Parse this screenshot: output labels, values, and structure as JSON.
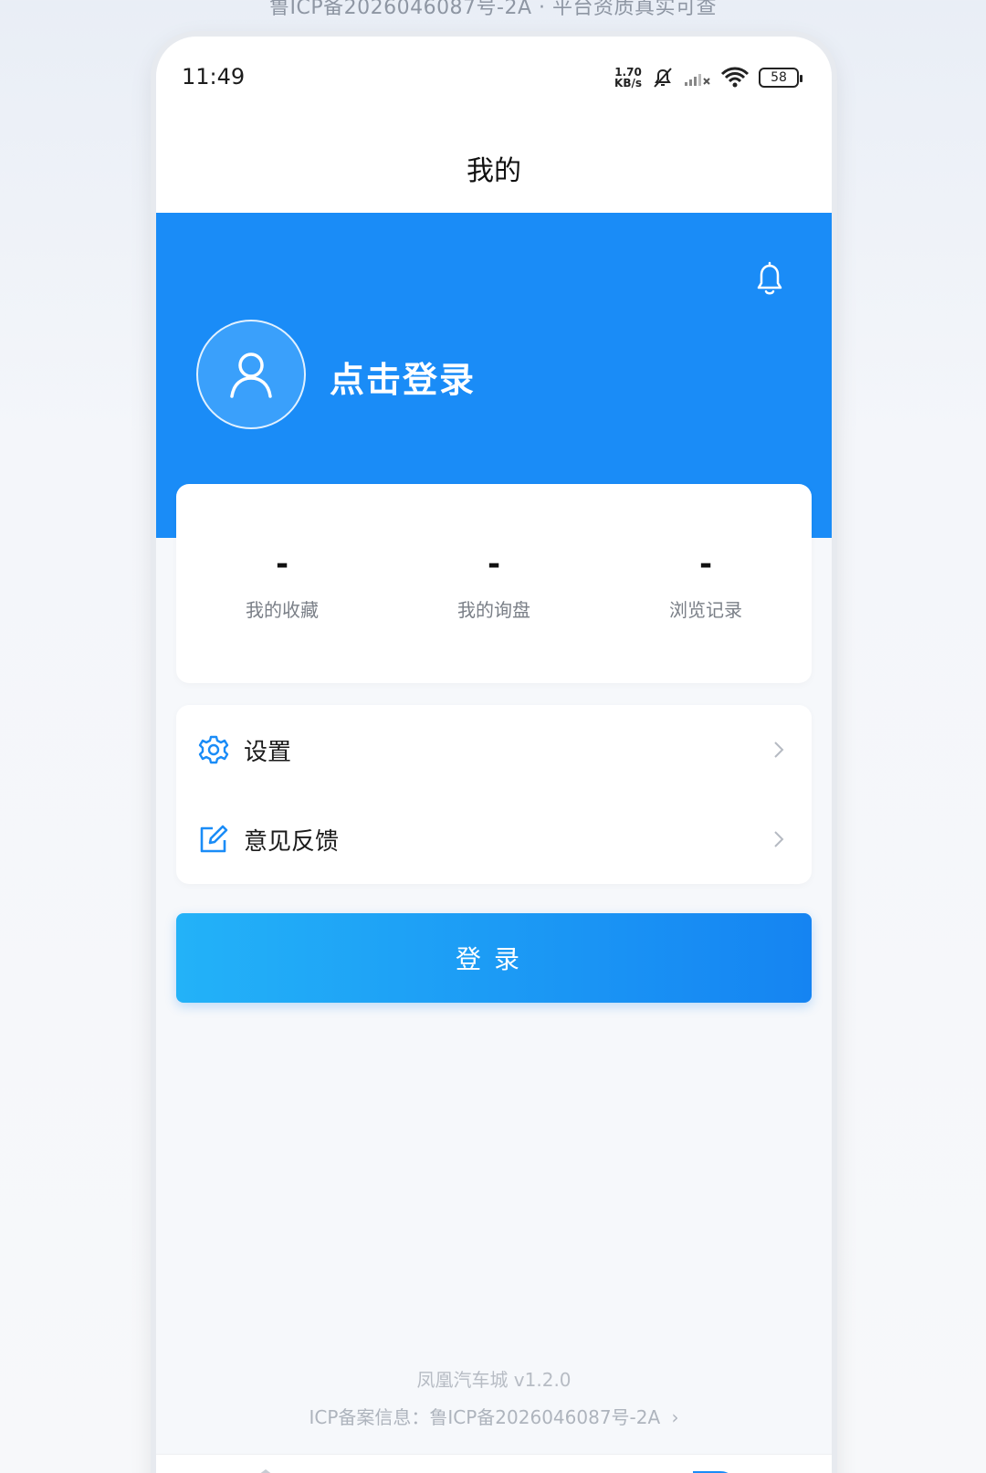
{
  "caption": {
    "text": "鲁ICP备2026046087号-2A  ·  平台资质真实可查"
  },
  "status_bar": {
    "time": "11:49",
    "net_speed_value": "1.70",
    "net_speed_unit": "KB/s",
    "battery": "58"
  },
  "header": {
    "title": "我的"
  },
  "profile": {
    "login_prompt": "点击登录"
  },
  "stats": [
    {
      "value": "-",
      "label": "我的收藏"
    },
    {
      "value": "-",
      "label": "我的询盘"
    },
    {
      "value": "-",
      "label": "浏览记录"
    }
  ],
  "menu": [
    {
      "label": "设置",
      "icon": "gear-icon"
    },
    {
      "label": "意见反馈",
      "icon": "edit-icon"
    }
  ],
  "login_button": {
    "label": "登录"
  },
  "footer": {
    "version": "凤凰汽车城 v1.2.0",
    "icp": "ICP备案信息：鲁ICP备2026046087号-2A"
  },
  "colors": {
    "accent": "#1a8cf7",
    "gradient_start": "#23b2f8",
    "gradient_end": "#1584f2"
  }
}
